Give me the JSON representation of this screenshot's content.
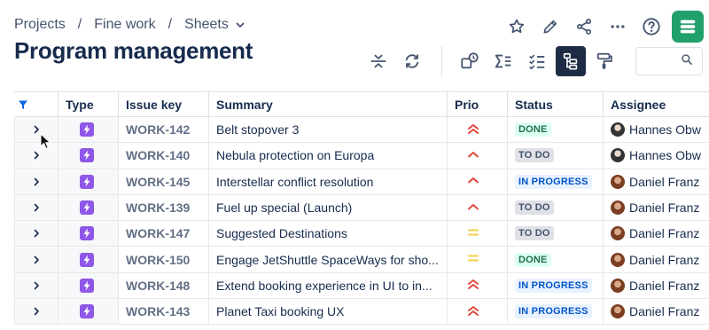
{
  "breadcrumb": {
    "items": [
      "Projects",
      "Fine work",
      "Sheets"
    ],
    "separator": "/"
  },
  "page": {
    "title": "Program management"
  },
  "table": {
    "columns": [
      "Type",
      "Issue key",
      "Summary",
      "Prio",
      "Status",
      "Assignee"
    ],
    "rows": [
      {
        "key": "WORK-142",
        "summary": "Belt stopover 3",
        "prio": "highest",
        "status": "DONE",
        "status_kind": "done",
        "assignee": "Hannes Obw",
        "avatar": "hannes"
      },
      {
        "key": "WORK-140",
        "summary": "Nebula protection on Europa",
        "prio": "high",
        "status": "TO DO",
        "status_kind": "todo",
        "assignee": "Hannes Obw",
        "avatar": "hannes"
      },
      {
        "key": "WORK-145",
        "summary": "Interstellar conflict resolution",
        "prio": "high",
        "status": "IN PROGRESS",
        "status_kind": "prog",
        "assignee": "Daniel Franz",
        "avatar": "daniel"
      },
      {
        "key": "WORK-139",
        "summary": "Fuel up special (Launch)",
        "prio": "high",
        "status": "TO DO",
        "status_kind": "todo",
        "assignee": "Daniel Franz",
        "avatar": "daniel"
      },
      {
        "key": "WORK-147",
        "summary": "Suggested Destinations",
        "prio": "medium",
        "status": "TO DO",
        "status_kind": "todo",
        "assignee": "Daniel Franz",
        "avatar": "daniel"
      },
      {
        "key": "WORK-150",
        "summary": "Engage JetShuttle SpaceWays for sho...",
        "prio": "medium",
        "status": "DONE",
        "status_kind": "done",
        "assignee": "Daniel Franz",
        "avatar": "daniel"
      },
      {
        "key": "WORK-148",
        "summary": "Extend booking experience in UI to in...",
        "prio": "highest",
        "status": "IN PROGRESS",
        "status_kind": "prog",
        "assignee": "Daniel Franz",
        "avatar": "daniel"
      },
      {
        "key": "WORK-143",
        "summary": "Planet Taxi booking UX",
        "prio": "highest",
        "status": "IN PROGRESS",
        "status_kind": "prog",
        "assignee": "Daniel Franz",
        "avatar": "daniel"
      }
    ]
  },
  "icons": {
    "top_actions": [
      "star-icon",
      "pencil-icon",
      "share-icon",
      "more-icon",
      "help-icon",
      "app-logo-icon"
    ],
    "toolbar": [
      "collapse-rows-icon",
      "refresh-icon",
      "grouping-icon",
      "sum-icon",
      "checklist-icon",
      "hierarchy-icon",
      "paint-roller-icon",
      "search-icon"
    ]
  },
  "colors": {
    "priority_highest": "#e2483d",
    "priority_high": "#e2483d",
    "priority_medium": "#f5cd47",
    "type_icon": "#8f57e8",
    "app_logo": "#22a06b",
    "active_tool": "#1d2b45",
    "filter_icon": "#0c66e4"
  }
}
